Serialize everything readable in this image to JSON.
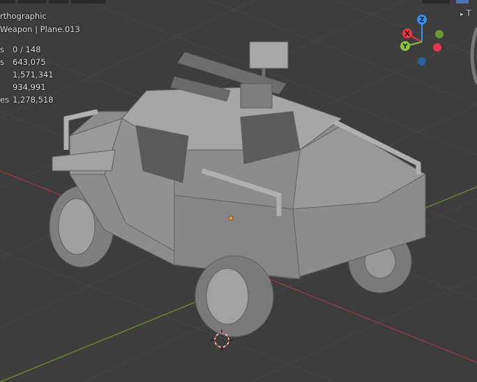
{
  "viewport": {
    "view_mode": "rthographic",
    "object_info": "Weapon | Plane.013",
    "stats": [
      {
        "label": "s",
        "value": "0 / 148"
      },
      {
        "label": "s",
        "value": "643,075"
      },
      {
        "label": "",
        "value": "1,571,341"
      },
      {
        "label": "",
        "value": "934,991"
      },
      {
        "label": "es",
        "value": "1,278,518"
      }
    ],
    "sidebar_toggle": "T"
  },
  "gizmo": {
    "x_label": "X",
    "y_label": "Y",
    "z_label": "Z",
    "colors": {
      "x": "#e8354a",
      "y": "#8bc53a",
      "z": "#3a8ff0",
      "neg_z": "#2a5e9c"
    }
  },
  "colors": {
    "background": "#3d3d3d",
    "grid": "#474747",
    "x_axis": "#9c3a40",
    "y_axis": "#6a8f2e",
    "model": "#8f8f8f"
  }
}
